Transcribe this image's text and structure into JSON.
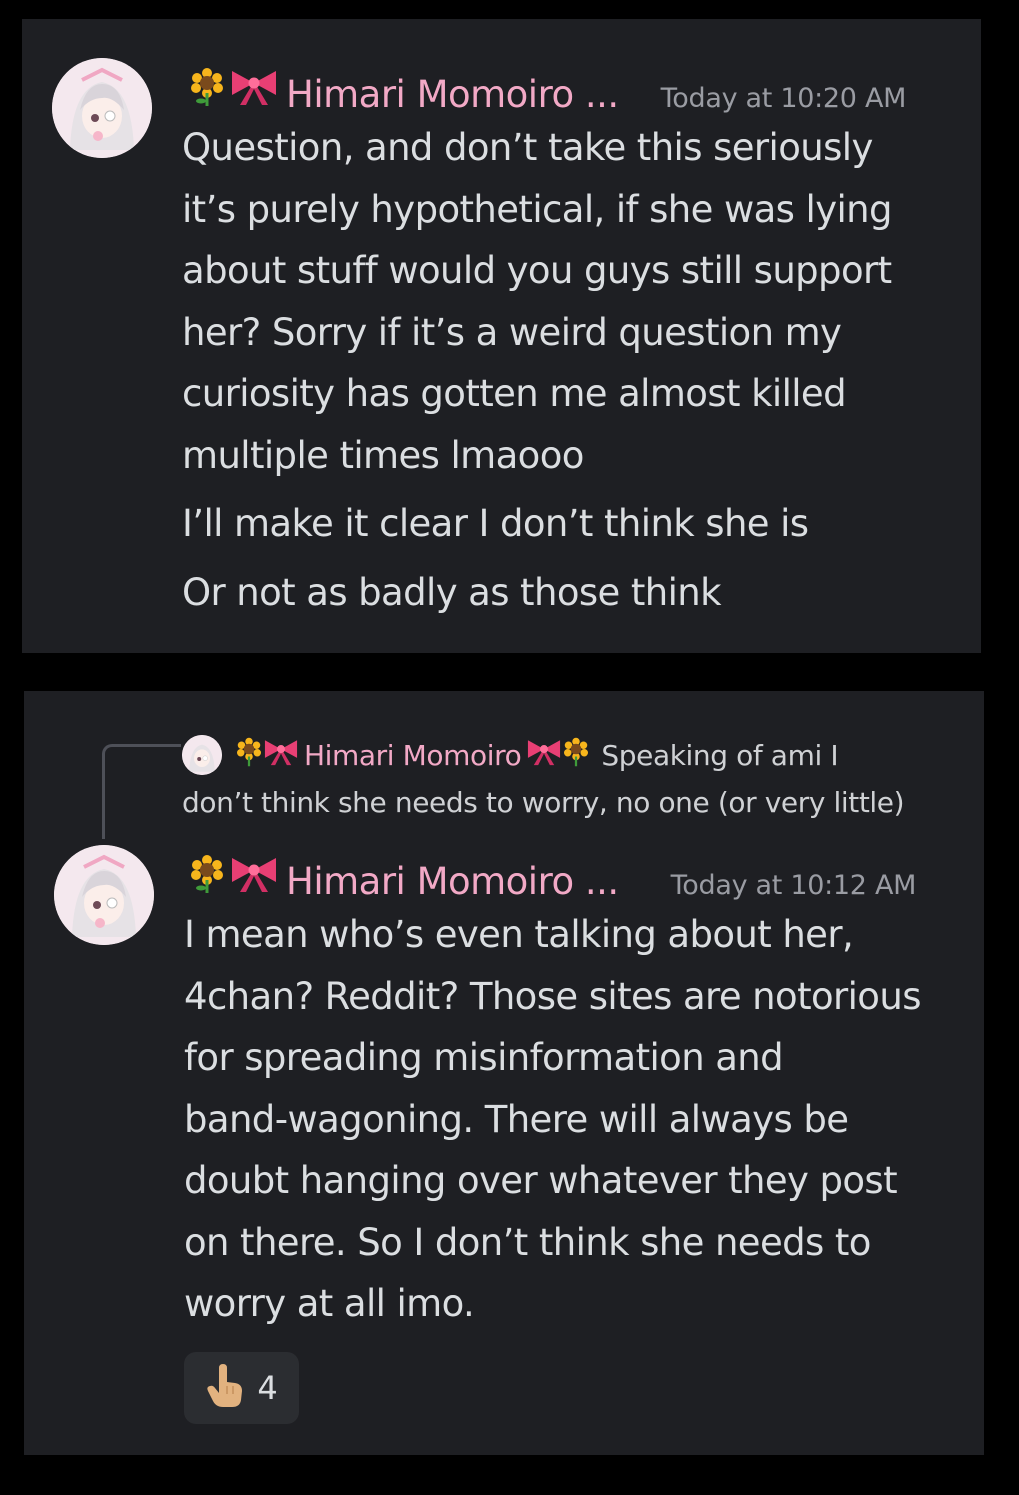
{
  "messages": [
    {
      "author": "Himari Momoiro ...",
      "author_emojis": [
        "sunflower-emoji",
        "ribbon-emoji"
      ],
      "timestamp": "Today at 10:20 AM",
      "lines": [
        "Question, and don’t take this seriously",
        "it’s purely hypothetical, if she was lying",
        "about stuff would you guys still support",
        "her? Sorry if it’s a weird question my",
        "curiosity has gotten me almost killed",
        "multiple times lmaooo"
      ],
      "followups": [
        "I’ll make it clear I don’t think she is",
        "Or not as badly as those think"
      ]
    },
    {
      "reply": {
        "author": "Himari Momoiro",
        "preview_line1": "Speaking of ami I",
        "preview_line2": "don’t think she needs to worry, no one (or very little)"
      },
      "author": "Himari Momoiro ...",
      "author_emojis": [
        "sunflower-emoji",
        "ribbon-emoji"
      ],
      "timestamp": "Today at 10:12 AM",
      "lines": [
        "I mean who’s even talking about her,",
        "4chan? Reddit? Those sites are notorious",
        "for spreading misinformation and",
        "band-wagoning. There will always be",
        "doubt hanging over whatever they post",
        "on there. So I don’t think she needs to",
        "worry at all imo."
      ],
      "reaction": {
        "icon": "pointing-hand-icon",
        "count": "4"
      }
    }
  ],
  "colors": {
    "background": "#000000",
    "panel": "#1e1f23",
    "username": "#f2a9c6",
    "timestamp": "#9a9ca3",
    "text": "#dbdee1"
  }
}
